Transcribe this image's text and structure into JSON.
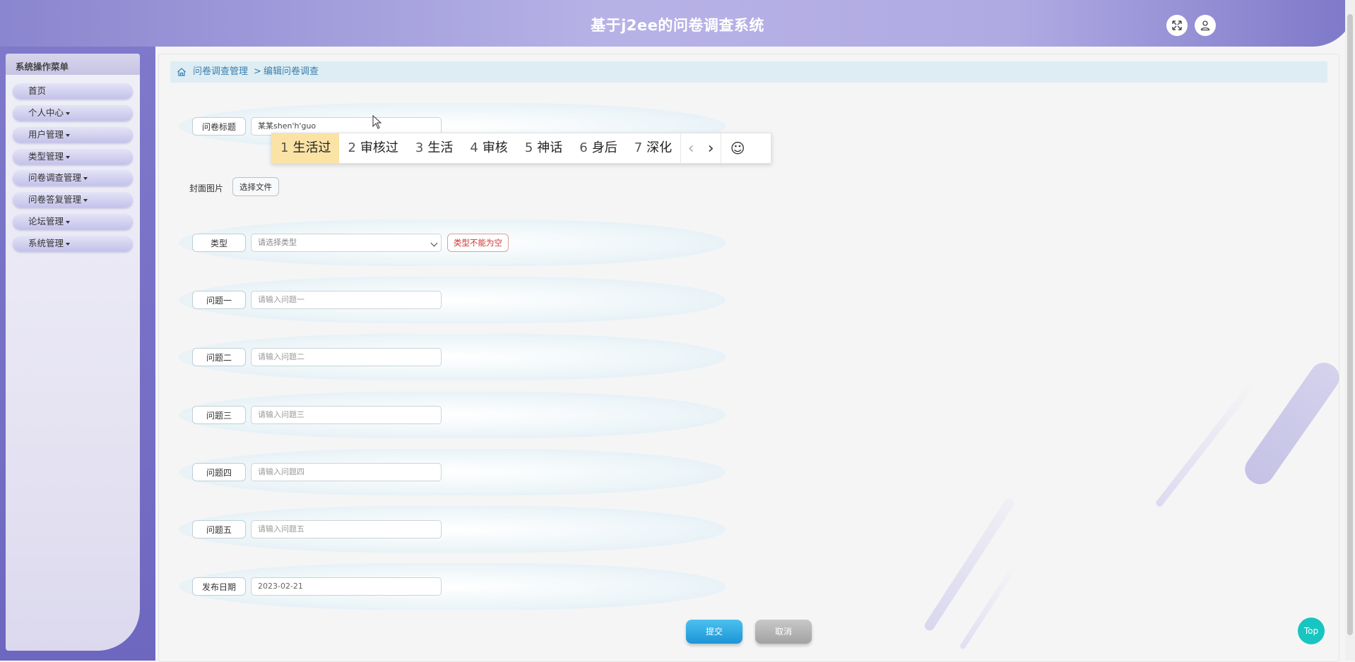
{
  "app": {
    "title": "基于j2ee的问卷调查系统"
  },
  "header": {
    "fullscreen_icon": "expand-icon",
    "user_icon": "user-icon"
  },
  "sidebar": {
    "title": "系统操作菜单",
    "items": [
      {
        "label": "首页",
        "has_caret": false
      },
      {
        "label": "个人中心",
        "has_caret": true
      },
      {
        "label": "用户管理",
        "has_caret": true
      },
      {
        "label": "类型管理",
        "has_caret": true
      },
      {
        "label": "问卷调查管理",
        "has_caret": true
      },
      {
        "label": "问卷答复管理",
        "has_caret": true
      },
      {
        "label": "论坛管理",
        "has_caret": true
      },
      {
        "label": "系统管理",
        "has_caret": true
      }
    ]
  },
  "breadcrumb": {
    "home_icon": "home-icon",
    "parent": "问卷调查管理",
    "separator": ">",
    "current": "编辑问卷调查"
  },
  "form": {
    "title_label": "问卷标题",
    "title_value": "某某shen'h'guo",
    "cover_label": "封面图片",
    "cover_button": "选择文件",
    "type_label": "类型",
    "type_selected": "请选择类型",
    "type_error": "类型不能为空",
    "q1_label": "问题一",
    "q1_placeholder": "请输入问题一",
    "q2_label": "问题二",
    "q2_placeholder": "请输入问题二",
    "q3_label": "问题三",
    "q3_placeholder": "请输入问题三",
    "q4_label": "问题四",
    "q4_placeholder": "请输入问题四",
    "q5_label": "问题五",
    "q5_placeholder": "请输入问题五",
    "date_label": "发布日期",
    "date_value": "2023-02-21",
    "submit": "提交",
    "cancel": "取消"
  },
  "ime": {
    "candidates": [
      {
        "n": "1",
        "text": "生活过"
      },
      {
        "n": "2",
        "text": "审核过"
      },
      {
        "n": "3",
        "text": "生活"
      },
      {
        "n": "4",
        "text": "审核"
      },
      {
        "n": "5",
        "text": "神话"
      },
      {
        "n": "6",
        "text": "身后"
      },
      {
        "n": "7",
        "text": "深化"
      }
    ],
    "prev": "‹",
    "next": "›",
    "emoji": "☺"
  },
  "top_button": "Top",
  "colors": {
    "accent": "#7f79cb",
    "submit": "#2fa8e0",
    "cancel": "#b5b5b5",
    "top": "#18c5c0",
    "error": "#d03333"
  }
}
